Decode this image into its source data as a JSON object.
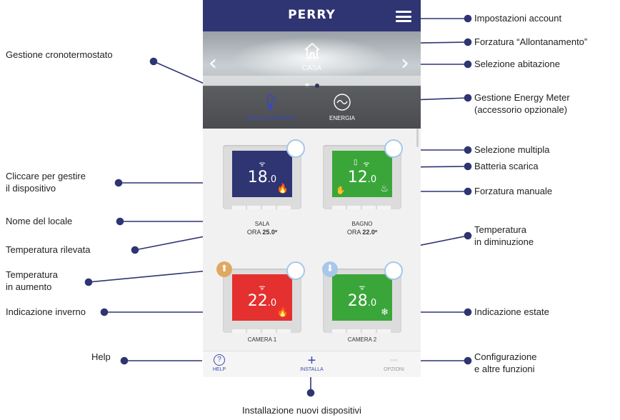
{
  "app": {
    "logo": "PERRY"
  },
  "hero": {
    "location": "CASA",
    "prev_arrow": "‹",
    "next_arrow": "›"
  },
  "tabs": [
    {
      "label": "RISCALDAMENTO",
      "color": "#3c4ab0"
    },
    {
      "label": "ENERGIA",
      "color": "#ffffff"
    }
  ],
  "devices": [
    {
      "room": "SALA",
      "now_label": "ORA",
      "now_value": "25.0º",
      "temp_int": "18",
      "temp_dec": ".0",
      "screen_color": "#2f3473",
      "mode_icon": "flame-icon"
    },
    {
      "room": "BAGNO",
      "now_label": "ORA",
      "now_value": "22.0º",
      "temp_int": "12",
      "temp_dec": ".0",
      "screen_color": "#3aa63a",
      "mode_icon": "flame-icon"
    },
    {
      "room": "CAMERA 1",
      "temp_int": "22",
      "temp_dec": ".0",
      "screen_color": "#e53030",
      "mode_icon": "flame-icon",
      "trend": "up"
    },
    {
      "room": "CAMERA 2",
      "temp_int": "28",
      "temp_dec": ".0",
      "screen_color": "#3aa63a",
      "mode_icon": "snowflake-icon",
      "trend": "down"
    }
  ],
  "bottom": {
    "help": "HELP",
    "installa": "INSTALLA",
    "opzioni": "OPZIONI",
    "help_symbol": "?",
    "installa_symbol": "+",
    "opzioni_symbol": "○○○"
  },
  "annotations": {
    "impostazioni": "Impostazioni account",
    "forzatura_allontanamento": "Forzatura “Allontanamento”",
    "selezione_abitazione": "Selezione abitazione",
    "gestione_crono": "Gestione cronotermostato",
    "energy_meter_1": "Gestione Energy Meter",
    "energy_meter_2": "(accessorio opzionale)",
    "selezione_multipla": "Selezione multipla",
    "batteria_scarica": "Batteria scarica",
    "forzatura_manuale": "Forzatura manuale",
    "cliccare_1": "Cliccare per gestire",
    "cliccare_2": "il dispositivo",
    "nome_locale": "Nome del locale",
    "temp_rilevata": "Temperatura rilevata",
    "temp_aumento_1": "Temperatura",
    "temp_aumento_2": "in aumento",
    "temp_diminuzione_1": "Temperatura",
    "temp_diminuzione_2": "in diminuzione",
    "indicazione_inverno": "Indicazione inverno",
    "indicazione_estate": "Indicazione estate",
    "help": "Help",
    "configurazione_1": "Configurazione",
    "configurazione_2": "e altre funzioni",
    "installazione": "Installazione nuovi dispositivi"
  },
  "colors": {
    "topbar": "#2f3473",
    "accent_blue": "#a9c7e8",
    "trend_up": "#e0a860",
    "trend_down": "#a9c7e8",
    "line": "#2f3473"
  }
}
